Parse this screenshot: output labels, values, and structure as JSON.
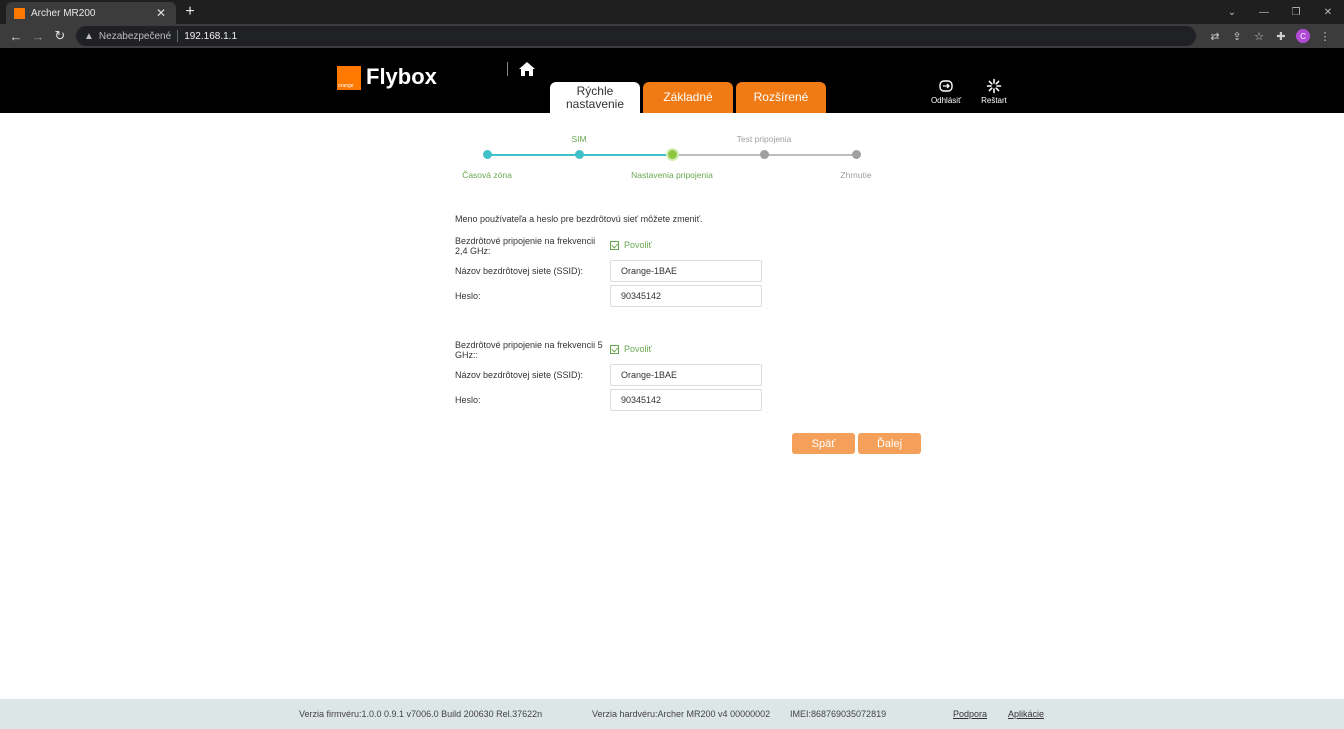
{
  "browser": {
    "tab_title": "Archer MR200",
    "security_text": "Nezabezpečené",
    "url": "192.168.1.1",
    "profile_initial": "C"
  },
  "header": {
    "logo_small": "orange",
    "logo_text": "Flybox",
    "tabs": [
      {
        "label_line1": "Rýchle",
        "label_line2": "nastavenie"
      },
      {
        "label": "Základné"
      },
      {
        "label": "Rozšírené"
      }
    ],
    "logout_label": "Odhlásiť",
    "restart_label": "Reštart"
  },
  "progress": {
    "steps": [
      {
        "label": "Časová zóna"
      },
      {
        "label": "SIM"
      },
      {
        "label": "Nastavenia pripojenia"
      },
      {
        "label": "Test pripojenia"
      },
      {
        "label": "Zhrnutie"
      }
    ],
    "current_step": 3
  },
  "form": {
    "intro": "Meno používateľa a heslo pre bezdrôtovú sieť môžete zmeniť.",
    "band24": {
      "label": "Bezdrôtové pripojenie na frekvencii 2,4 GHz:",
      "enable_label": "Povoliť",
      "ssid_label": "Názov bezdrôtovej siete (SSID):",
      "ssid_value": "Orange-1BAE",
      "password_label": "Heslo:",
      "password_value": "90345142"
    },
    "band5": {
      "label": "Bezdrôtové pripojenie na frekvencii 5 GHz::",
      "enable_label": "Povoliť",
      "ssid_label": "Názov bezdrôtovej siete (SSID):",
      "ssid_value": "Orange-1BAE",
      "password_label": "Heslo:",
      "password_value": "90345142"
    },
    "back_label": "Späť",
    "next_label": "Ďalej"
  },
  "footer": {
    "firmware": "Verzia firmvéru:1.0.0 0.9.1 v7006.0 Build 200630 Rel.37622n",
    "hardware": "Verzia hardvéru:Archer MR200 v4 00000002",
    "imei": "IMEI:868769035072819",
    "support_link": "Podpora",
    "apps_link": "Aplikácie"
  },
  "colors": {
    "accent_orange": "#f07a14",
    "button_orange": "#f5a05a",
    "progress_done": "#40c0c8",
    "progress_label_done": "#6aa84f",
    "progress_pending": "#a0a0a0"
  }
}
